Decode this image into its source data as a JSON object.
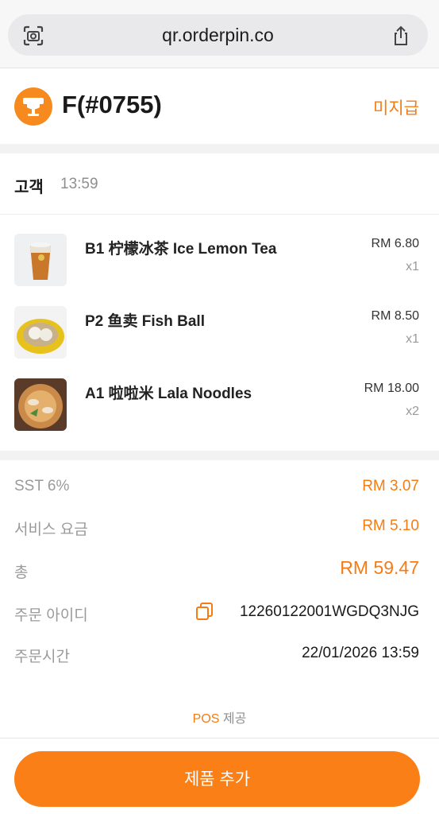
{
  "browser": {
    "url": "qr.orderpin.co",
    "left_icon": "screenshot-capture-icon",
    "right_icon": "share-icon"
  },
  "header": {
    "table": "F(#0755)",
    "status": "미지급",
    "logo_icon": "restaurant-table-icon"
  },
  "customer": {
    "label": "고객",
    "time": "13:59"
  },
  "items": [
    {
      "name": "B1 柠檬冰茶 Ice Lemon Tea",
      "price": "RM 6.80",
      "qty": "x1",
      "image": "iced-lemon-tea-photo"
    },
    {
      "name": "P2 鱼卖 Fish Ball",
      "price": "RM 8.50",
      "qty": "x1",
      "image": "fish-ball-photo"
    },
    {
      "name": "A1 啦啦米 Lala Noodles",
      "price": "RM 18.00",
      "qty": "x2",
      "image": "lala-noodles-photo"
    }
  ],
  "summary": {
    "sst_label": "SST 6%",
    "sst_value": "RM 3.07",
    "service_label": "서비스 요금",
    "service_value": "RM 5.10",
    "total_label": "총",
    "total_value": "RM 59.47",
    "order_id_label": "주문 아이디",
    "order_id_value": "12260122001WGDQ3NJG",
    "order_time_label": "주문시간",
    "order_time_value": "22/01/2026 13:59"
  },
  "footer": {
    "pos": "POS",
    "provided": "제공",
    "add_button": "제품 추가"
  },
  "colors": {
    "accent": "#f57c14",
    "button": "#fb7f17"
  }
}
